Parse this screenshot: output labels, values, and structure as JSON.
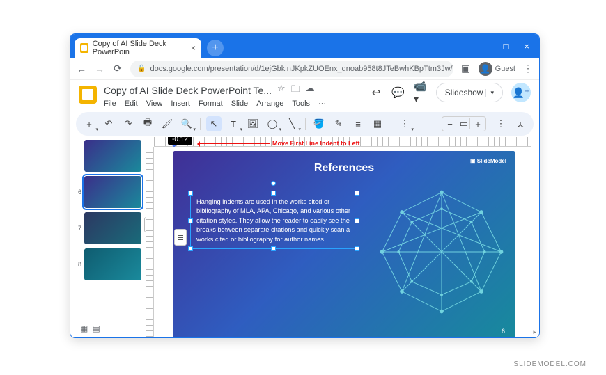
{
  "browser": {
    "tab_title": "Copy of AI Slide Deck PowerPoin",
    "url": "docs.google.com/presentation/d/1ejGbkinJKpkZUOEnx_dnoab958t8JTeBwhKBpTtm3Jw/edit#slide=",
    "guest_label": "Guest"
  },
  "doc": {
    "title": "Copy of AI Slide Deck PowerPoint Te...",
    "menus": [
      "File",
      "Edit",
      "View",
      "Insert",
      "Format",
      "Slide",
      "Arrange",
      "Tools",
      "···"
    ],
    "slideshow_label": "Slideshow"
  },
  "ruler": {
    "tooltip_value": "-0.12",
    "annotation": "Move First Line Indent to Left"
  },
  "thumbs": [
    {
      "num": "",
      "cls": ""
    },
    {
      "num": "6",
      "cls": "selected"
    },
    {
      "num": "7",
      "cls": "t7"
    },
    {
      "num": "8",
      "cls": "t8"
    }
  ],
  "slide": {
    "title": "References",
    "logo": "SlideModel",
    "body": "Hanging indents are used in the works cited or bibliography of MLA, APA, Chicago, and various other citation styles. They allow the reader to easily see the breaks between separate citations and quickly scan a works cited or bibliography for author names.",
    "page_number": "6"
  },
  "watermark": "SLIDEMODEL.COM"
}
